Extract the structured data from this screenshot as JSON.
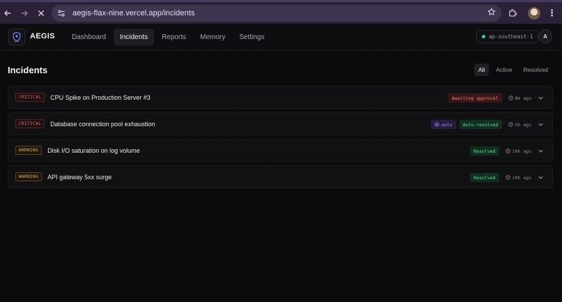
{
  "browser": {
    "url": "aegis-flax-nine.vercel.app/incidents"
  },
  "app": {
    "brand": "AEGIS",
    "nav": [
      {
        "label": "Dashboard"
      },
      {
        "label": "Incidents"
      },
      {
        "label": "Reports"
      },
      {
        "label": "Memory"
      },
      {
        "label": "Settings"
      }
    ],
    "region": "ap-southeast-1",
    "avatar_initial": "A"
  },
  "page": {
    "title": "Incidents",
    "filters": [
      {
        "label": "All"
      },
      {
        "label": "Active"
      },
      {
        "label": "Resolved"
      }
    ]
  },
  "incidents": [
    {
      "severity": "CRITICAL",
      "title": "CPU Spike on Production Server #3",
      "auto": "",
      "status": "Awaiting approval",
      "time": "8m ago"
    },
    {
      "severity": "CRITICAL",
      "title": "Database connection pool exhaustion",
      "auto": "auto",
      "status": "Auto-resolved",
      "time": "5h ago"
    },
    {
      "severity": "WARNING",
      "title": "Disk I/O saturation on log volume",
      "auto": "",
      "status": "Resolved",
      "time": "16h ago"
    },
    {
      "severity": "WARNING",
      "title": "API gateway 5xx surge",
      "auto": "",
      "status": "Resolved",
      "time": "20h ago"
    }
  ],
  "colors": {
    "critical": "#f26d6d",
    "warning": "#f0b54a",
    "resolved": "#5fdc97",
    "awaiting": "#f07a7a",
    "auto": "#a98af5",
    "region_dot": "#34d399"
  },
  "icons": {
    "back": "arrow-left-icon",
    "forward": "arrow-right-icon",
    "stop": "close-icon",
    "site_info": "tune-icon",
    "bookmark": "star-icon",
    "extensions": "puzzle-icon",
    "menu": "kebab-icon",
    "time": "clock-icon",
    "expand": "chevron-down-icon"
  }
}
